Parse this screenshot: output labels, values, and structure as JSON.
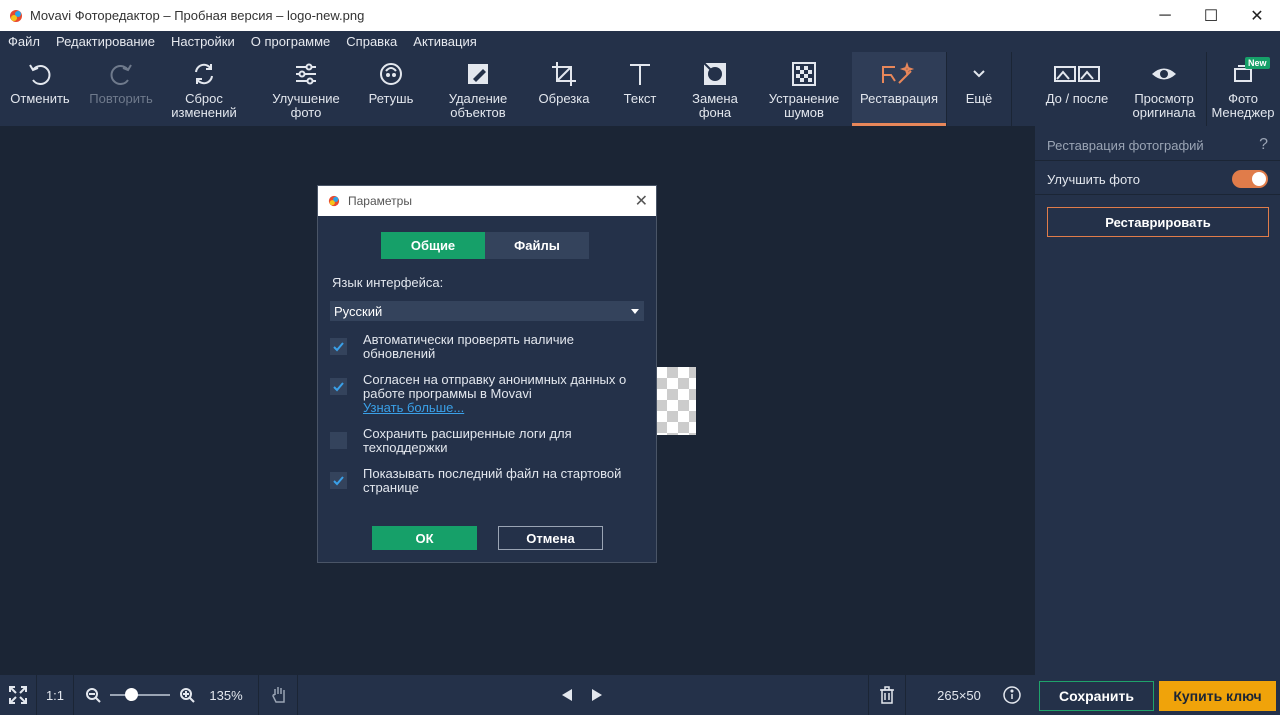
{
  "window": {
    "title": "Movavi Фоторедактор – Пробная версия – logo-new.png"
  },
  "menu": [
    "Файл",
    "Редактирование",
    "Настройки",
    "О программе",
    "Справка",
    "Активация"
  ],
  "toolbar": {
    "undo": "Отменить",
    "redo": "Повторить",
    "reset": "Сброс изменений",
    "enhance": "Улучшение фото",
    "retouch": "Ретушь",
    "remove_objects": "Удаление объектов",
    "crop": "Обрезка",
    "text": "Текст",
    "replace_bg": "Замена фона",
    "denoise": "Устранение шумов",
    "restore": "Реставрация",
    "more": "Ещё",
    "before_after": "До / после",
    "view_original": "Просмотр оригинала",
    "photo_manager": "Фото Менеджер",
    "new_badge": "New"
  },
  "right_panel": {
    "heading": "Реставрация фотографий",
    "help": "?",
    "enhance_label": "Улучшить фото",
    "enhance_on": true,
    "restore_button": "Реставрировать"
  },
  "dialog": {
    "title": "Параметры",
    "tabs": [
      "Общие",
      "Файлы"
    ],
    "language_label": "Язык интерфейса:",
    "language_value": "Русский",
    "options": [
      {
        "text": "Автоматически проверять наличие обновлений",
        "checked": true
      },
      {
        "text": "Согласен на отправку анонимных данных о работе программы в Movavi",
        "checked": true,
        "link": "Узнать больше..."
      },
      {
        "text": "Сохранить расширенные логи для техподдержки",
        "checked": false
      },
      {
        "text": "Показывать последний файл на стартовой странице",
        "checked": true
      }
    ],
    "ok": "ОК",
    "cancel": "Отмена"
  },
  "bottom": {
    "fit": "1:1",
    "zoom": "135%",
    "zoom_fraction": 0.35,
    "size": "265×50",
    "save": "Сохранить",
    "buy": "Купить ключ"
  },
  "colors": {
    "accent": "#e07c4a",
    "green": "#16a069",
    "buy": "#f0a30a",
    "bg": "#1b2535",
    "panel": "#243149"
  }
}
